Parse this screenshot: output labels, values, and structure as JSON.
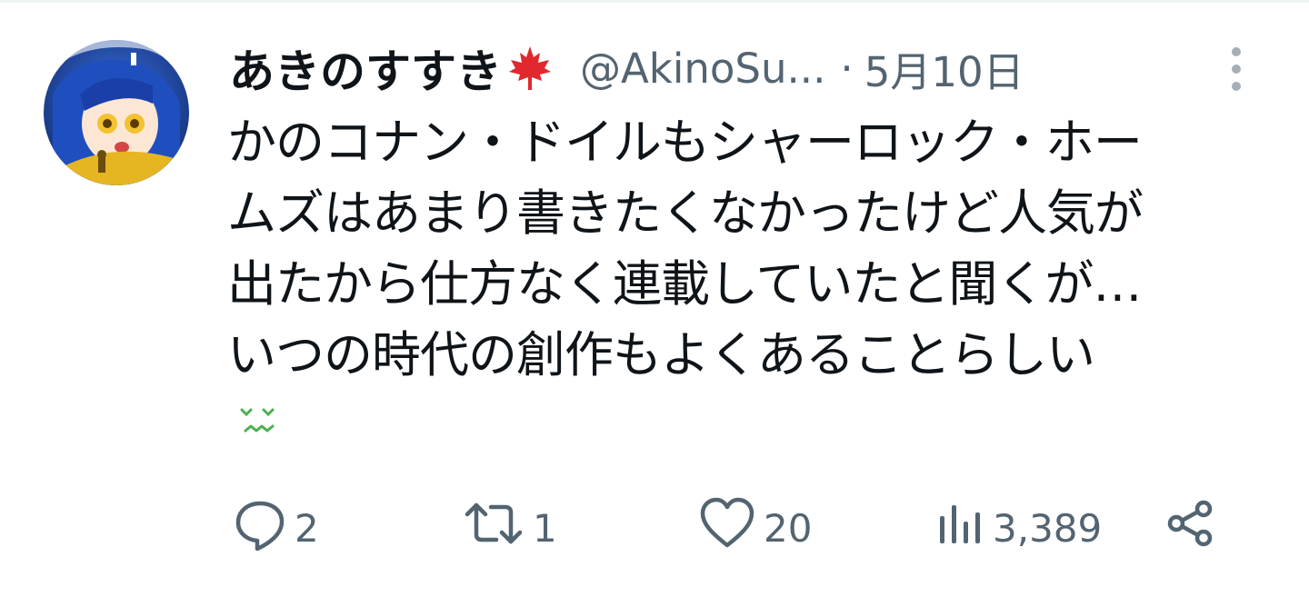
{
  "tweet": {
    "display_name": "あきのすすき",
    "name_emoji": "maple-leaf-icon",
    "handle": "@AkinoSu...",
    "separator": "·",
    "date": "5月10日",
    "text": "かのコナン・ドイルもシャーロック・ホー\nムズはあまり書きたくなかったけど人気が\n出たから仕方なく連載していたと聞くが…\nいつの時代の創作もよくあることらしい",
    "trailing_emoji": "confounded-face-icon"
  },
  "actions": {
    "reply_count": "2",
    "retweet_count": "1",
    "like_count": "20",
    "views_count": "3,389"
  },
  "colors": {
    "text": "#0f1419",
    "secondary": "#536471",
    "maple": "#e0282e",
    "emoji_green": "#4caf50"
  }
}
